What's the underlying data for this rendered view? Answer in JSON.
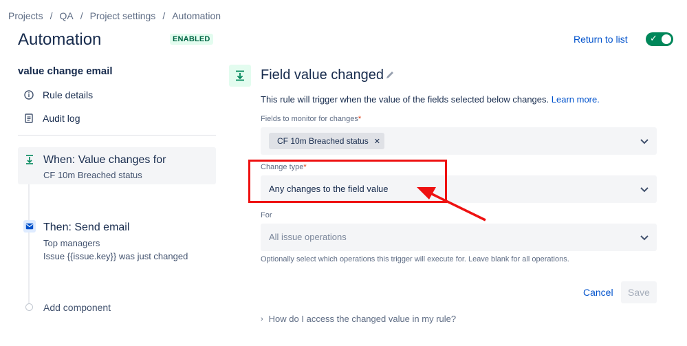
{
  "breadcrumb": {
    "items": [
      "Projects",
      "QA",
      "Project settings",
      "Automation"
    ],
    "separator": "/"
  },
  "header": {
    "title": "Automation",
    "status_badge": "ENABLED",
    "return_link": "Return to list",
    "toggle_on": true
  },
  "sidebar": {
    "rule_name": "value change email",
    "links": [
      {
        "label": "Rule details",
        "icon": "info-icon"
      },
      {
        "label": "Audit log",
        "icon": "document-icon"
      }
    ],
    "trigger": {
      "title": "When: Value changes for",
      "subtitle": "CF 10m Breached status",
      "icon": "trigger-arrow-icon"
    },
    "action": {
      "title": "Then: Send email",
      "lines": [
        "Top managers",
        "Issue {{issue.key}} was just changed"
      ],
      "icon": "mail-icon"
    },
    "add_component": "Add component"
  },
  "panel": {
    "title": "Field value changed",
    "description": "This rule will trigger when the value of the fields selected below changes.",
    "learn_more": "Learn more.",
    "fields_label": "Fields to monitor for changes",
    "required_mark": "*",
    "fields_selected": [
      "CF 10m Breached status"
    ],
    "change_type_label": "Change type",
    "change_type_value": "Any changes to the field value",
    "for_label": "For",
    "for_placeholder": "All issue operations",
    "for_help": "Optionally select which operations this trigger will execute for. Leave blank for all operations.",
    "cancel_label": "Cancel",
    "save_label": "Save",
    "faq_label": "How do I access the changed value in my rule?"
  },
  "colors": {
    "accent": "#0052cc",
    "enabled_green": "#006644",
    "toggle_green": "#00875a",
    "annotation_red": "#ee1111"
  }
}
